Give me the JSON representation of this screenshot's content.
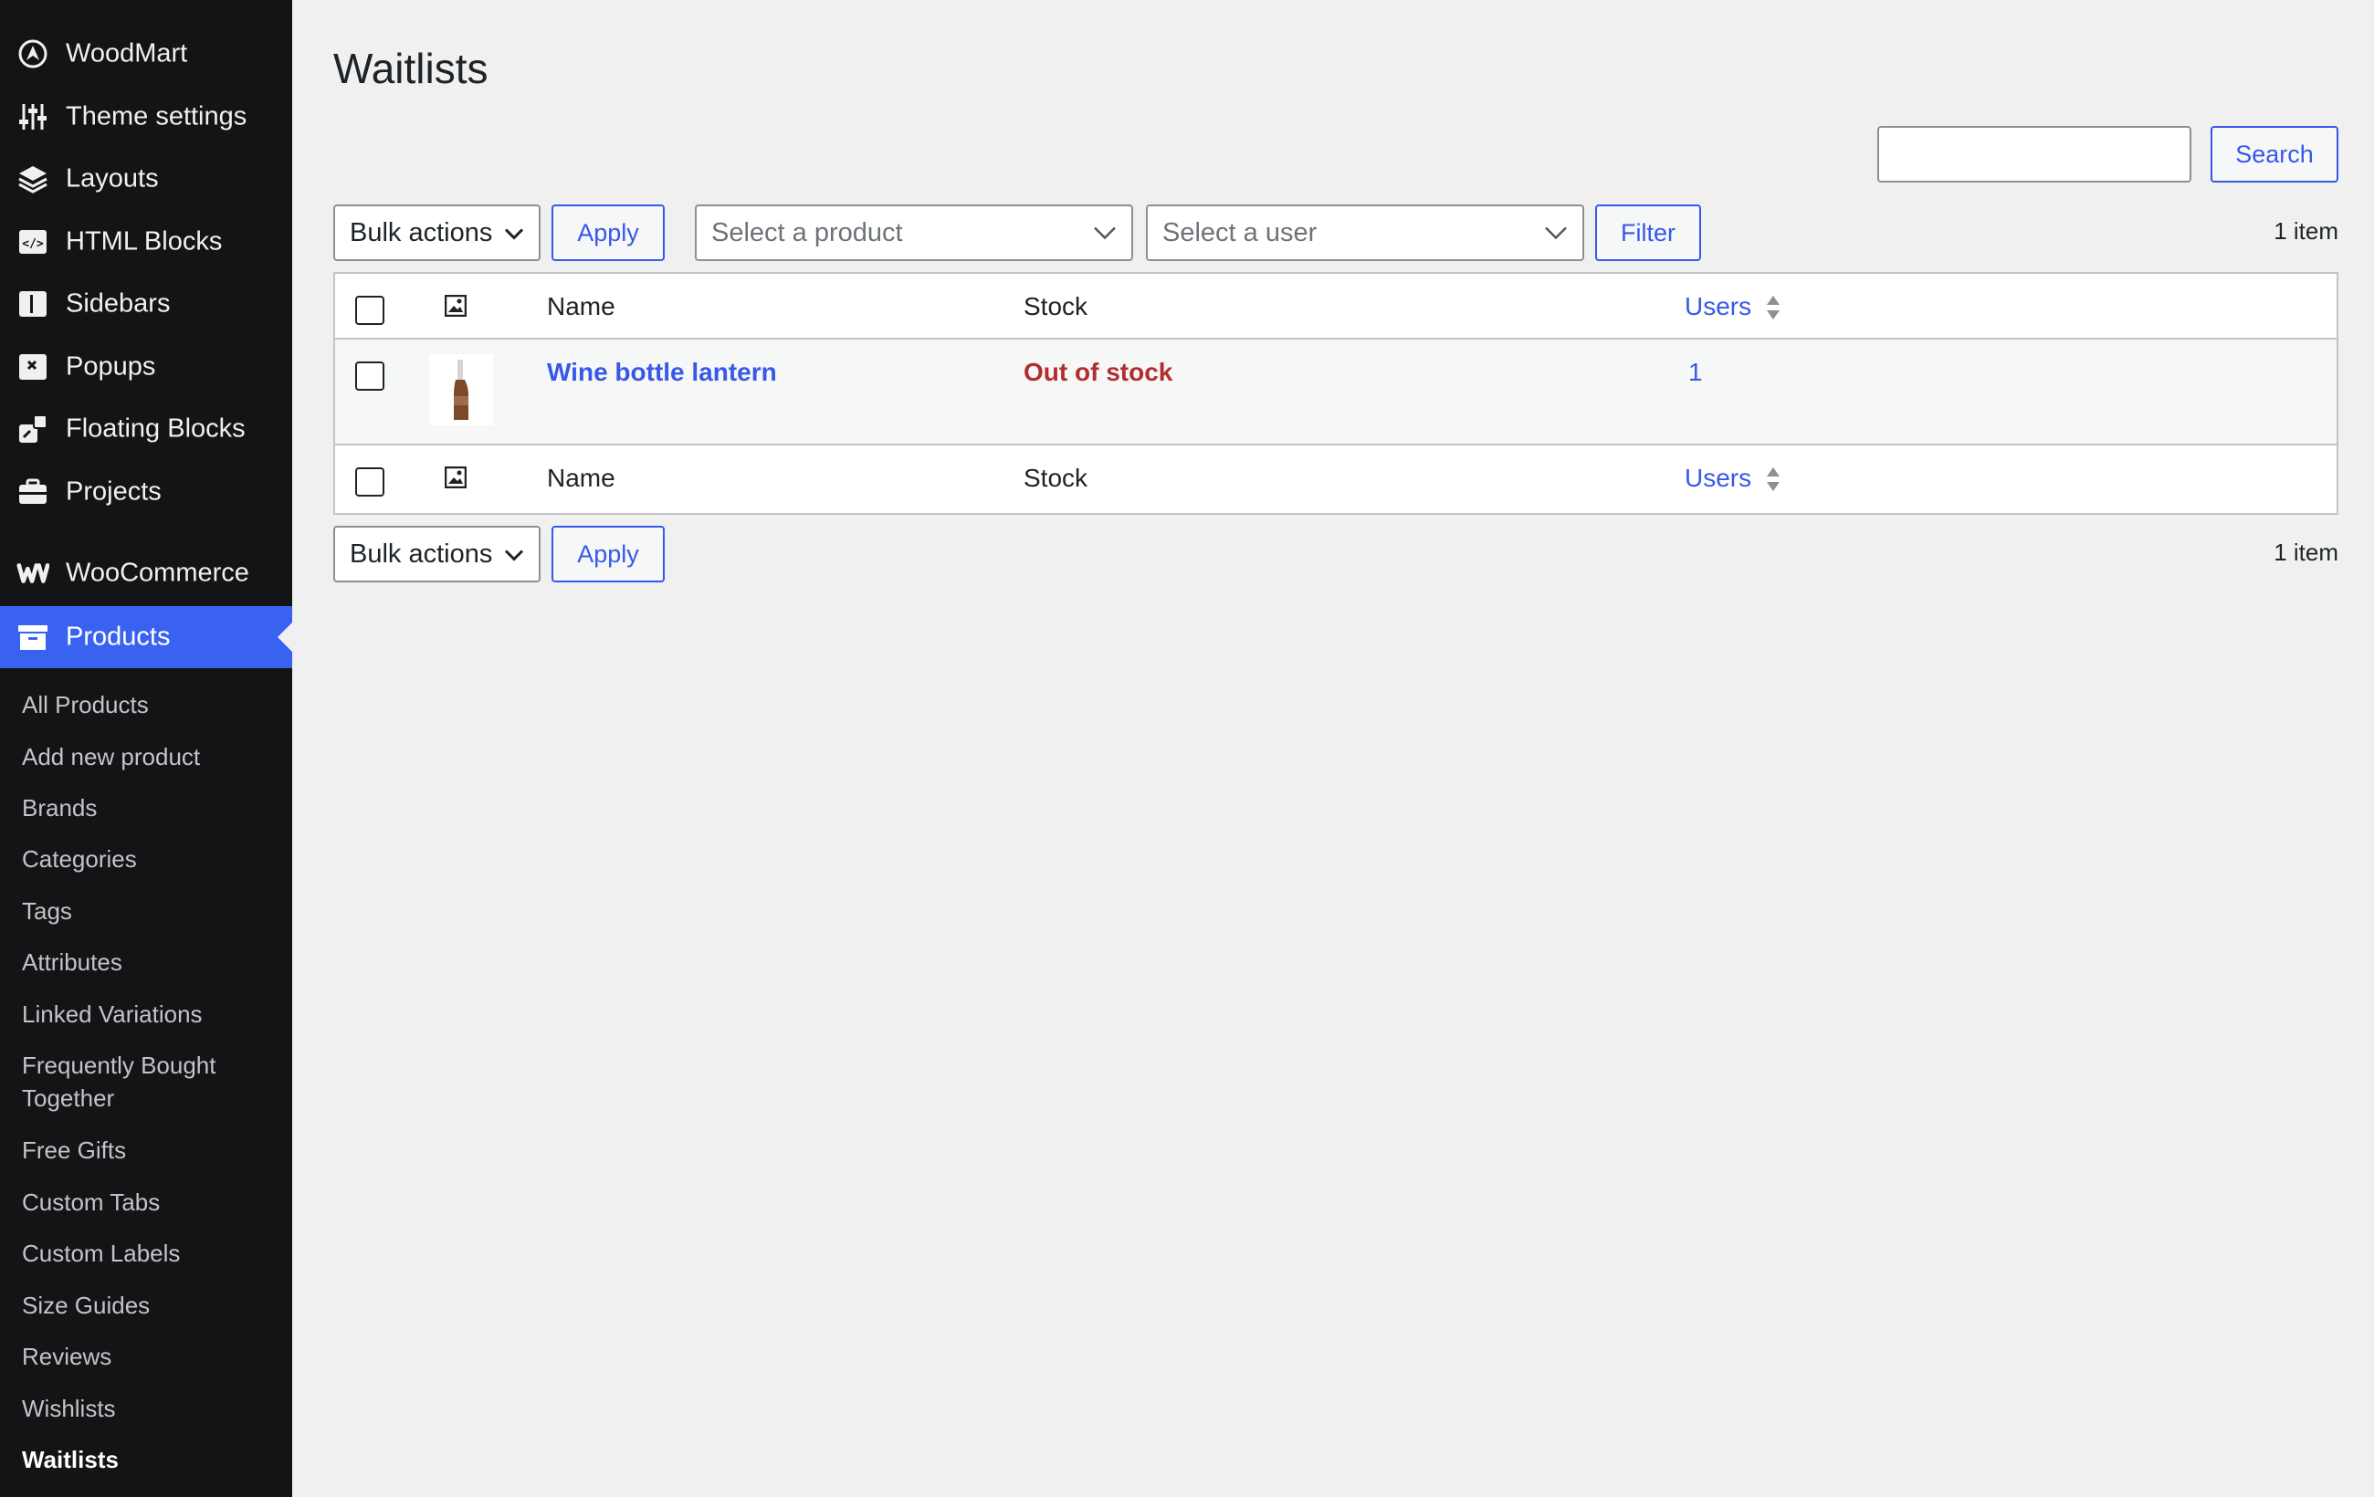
{
  "sidebar": {
    "top_items": [
      {
        "label": "WoodMart",
        "icon": "woodmart-logo-icon"
      },
      {
        "label": "Theme settings",
        "icon": "sliders-icon"
      },
      {
        "label": "Layouts",
        "icon": "layers-icon"
      },
      {
        "label": "HTML Blocks",
        "icon": "code-block-icon"
      },
      {
        "label": "Sidebars",
        "icon": "sidebar-icon"
      },
      {
        "label": "Popups",
        "icon": "popup-icon"
      },
      {
        "label": "Floating Blocks",
        "icon": "floating-blocks-icon"
      },
      {
        "label": "Projects",
        "icon": "briefcase-icon"
      }
    ],
    "woocommerce": {
      "label": "WooCommerce",
      "icon": "woocommerce-icon"
    },
    "products": {
      "label": "Products",
      "icon": "archive-icon"
    },
    "sub_items": [
      "All Products",
      "Add new product",
      "Brands",
      "Categories",
      "Tags",
      "Attributes",
      "Linked Variations",
      "Frequently Bought Together",
      "Free Gifts",
      "Custom Tabs",
      "Custom Labels",
      "Size Guides",
      "Reviews",
      "Wishlists",
      "Waitlists"
    ],
    "current_sub": "Waitlists"
  },
  "page": {
    "title": "Waitlists",
    "search_button": "Search",
    "search_value": ""
  },
  "toolbar_top": {
    "bulk_actions": "Bulk actions",
    "apply": "Apply",
    "product_placeholder": "Select a product",
    "user_placeholder": "Select a user",
    "filter": "Filter",
    "count": "1 item"
  },
  "table": {
    "columns": {
      "name": "Name",
      "stock": "Stock",
      "users": "Users"
    },
    "rows": [
      {
        "name": "Wine bottle lantern",
        "stock": "Out of stock",
        "users": "1"
      }
    ]
  },
  "toolbar_bottom": {
    "bulk_actions": "Bulk actions",
    "apply": "Apply",
    "count": "1 item"
  },
  "colors": {
    "accent": "#3858e9",
    "sidebar_bg": "#121416",
    "active_menu": "#3a62f0",
    "out_of_stock": "#b32d2e"
  }
}
